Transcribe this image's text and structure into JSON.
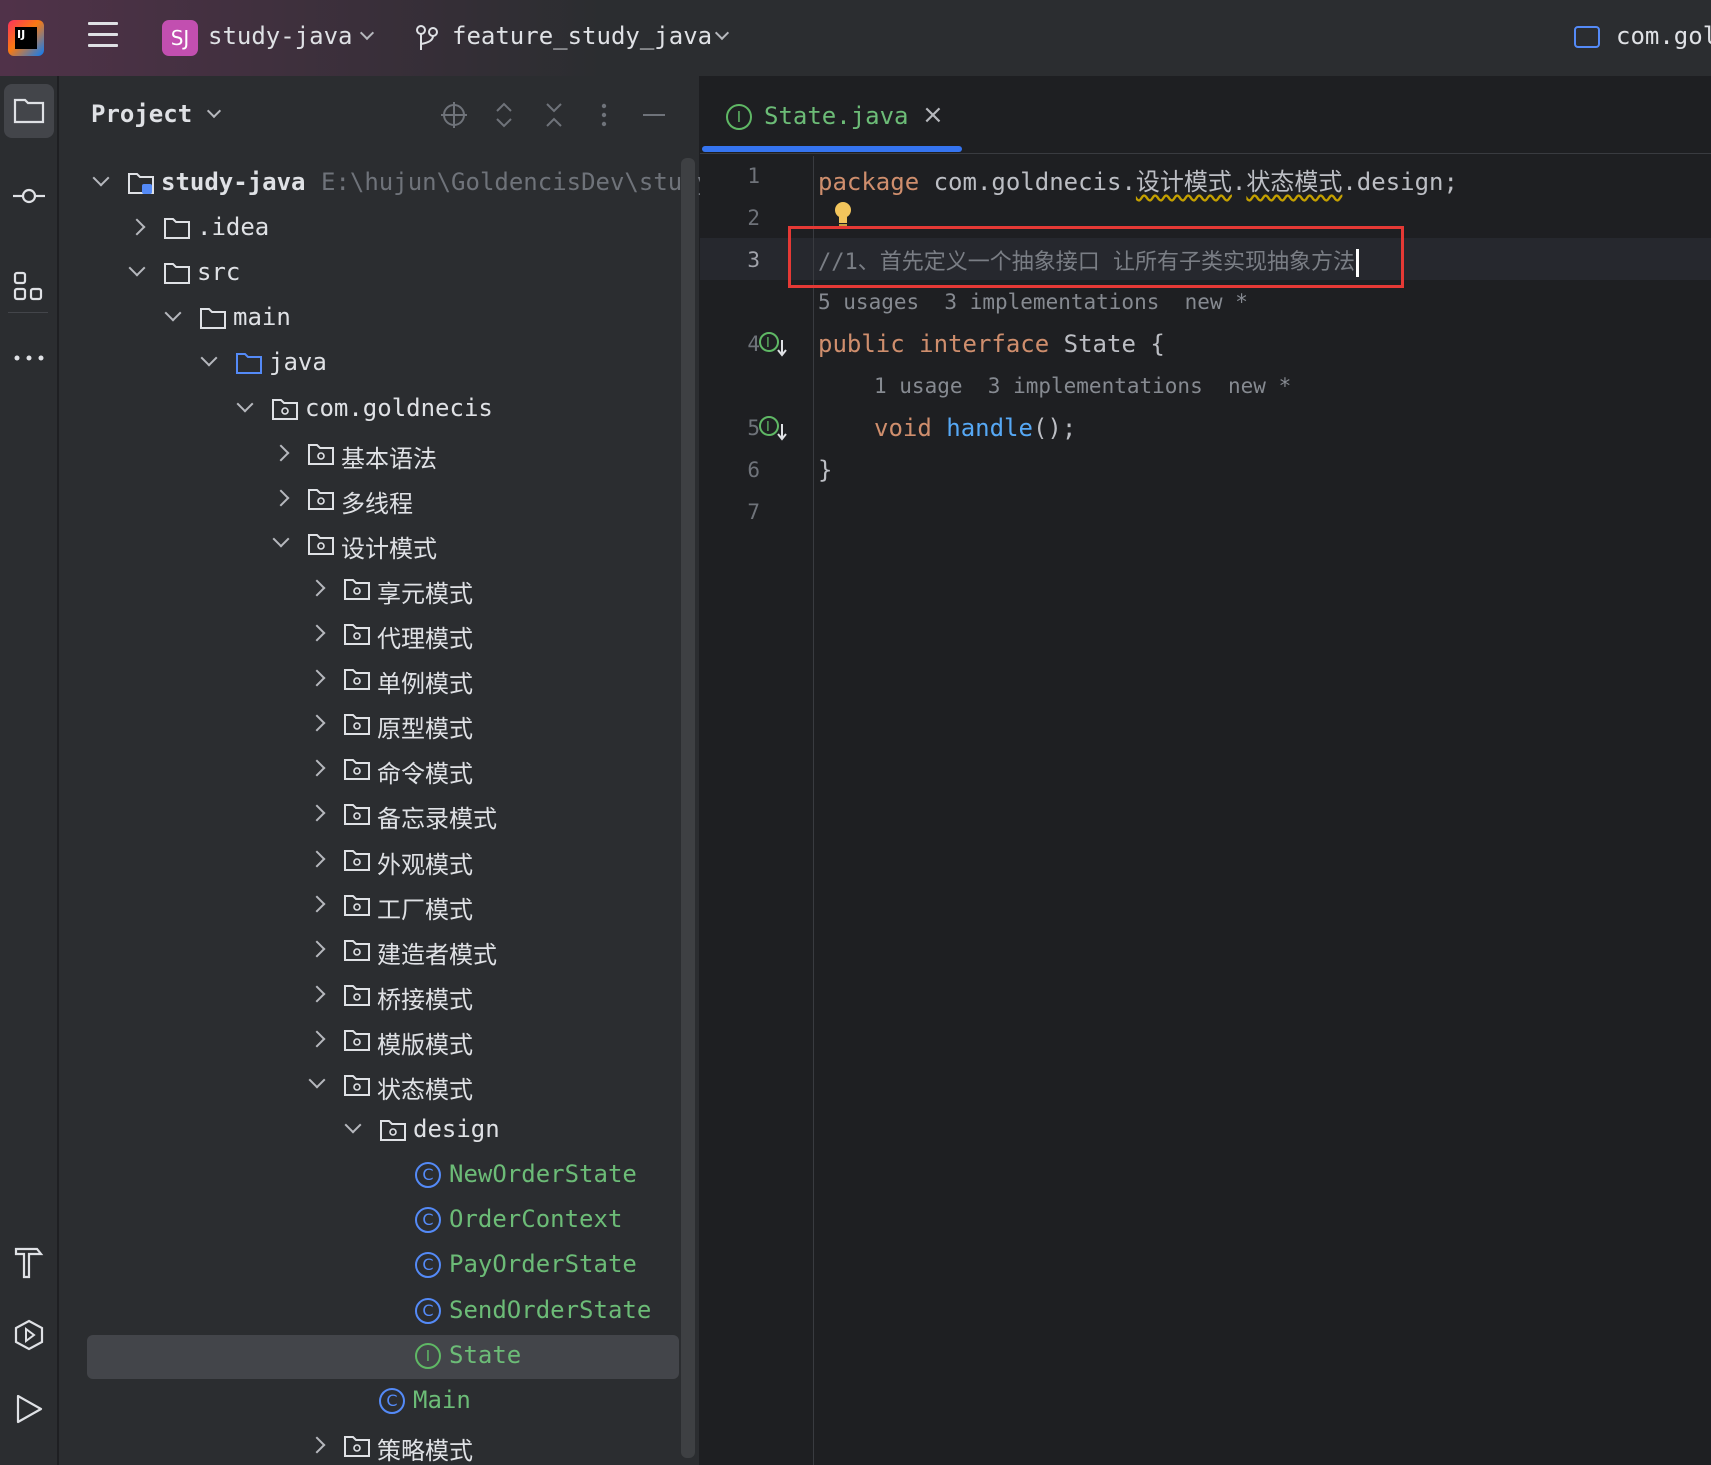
{
  "titlebar": {
    "project_badge": "SJ",
    "project_name": "study-java",
    "branch_name": "feature_study_java",
    "right_config": "com.gol"
  },
  "project_panel": {
    "title": "Project",
    "tree": [
      {
        "label": "study-java",
        "path": "E:\\hujun\\GoldencisDev\\study-",
        "type": "module",
        "level": 0,
        "open": true
      },
      {
        "label": ".idea",
        "type": "folder",
        "level": 1,
        "open": false
      },
      {
        "label": "src",
        "type": "folder",
        "level": 1,
        "open": true
      },
      {
        "label": "main",
        "type": "folder",
        "level": 2,
        "open": true
      },
      {
        "label": "java",
        "type": "source",
        "level": 3,
        "open": true
      },
      {
        "label": "com.goldnecis",
        "type": "package",
        "level": 4,
        "open": true
      },
      {
        "label": "基本语法",
        "type": "package",
        "level": 5,
        "open": false
      },
      {
        "label": "多线程",
        "type": "package",
        "level": 5,
        "open": false
      },
      {
        "label": "设计模式",
        "type": "package",
        "level": 5,
        "open": true
      },
      {
        "label": "享元模式",
        "type": "package",
        "level": 6,
        "open": false
      },
      {
        "label": "代理模式",
        "type": "package",
        "level": 6,
        "open": false
      },
      {
        "label": "单例模式",
        "type": "package",
        "level": 6,
        "open": false
      },
      {
        "label": "原型模式",
        "type": "package",
        "level": 6,
        "open": false
      },
      {
        "label": "命令模式",
        "type": "package",
        "level": 6,
        "open": false
      },
      {
        "label": "备忘录模式",
        "type": "package",
        "level": 6,
        "open": false
      },
      {
        "label": "外观模式",
        "type": "package",
        "level": 6,
        "open": false
      },
      {
        "label": "工厂模式",
        "type": "package",
        "level": 6,
        "open": false
      },
      {
        "label": "建造者模式",
        "type": "package",
        "level": 6,
        "open": false
      },
      {
        "label": "桥接模式",
        "type": "package",
        "level": 6,
        "open": false
      },
      {
        "label": "模版模式",
        "type": "package",
        "level": 6,
        "open": false
      },
      {
        "label": "状态模式",
        "type": "package",
        "level": 6,
        "open": true
      },
      {
        "label": "design",
        "type": "package",
        "level": 7,
        "open": true
      },
      {
        "label": "NewOrderState",
        "type": "class",
        "level": 8
      },
      {
        "label": "OrderContext",
        "type": "class",
        "level": 8
      },
      {
        "label": "PayOrderState",
        "type": "class",
        "level": 8
      },
      {
        "label": "SendOrderState",
        "type": "class",
        "level": 8
      },
      {
        "label": "State",
        "type": "interface",
        "level": 8,
        "selected": true
      },
      {
        "label": "Main",
        "type": "class",
        "level": 7
      },
      {
        "label": "策略模式",
        "type": "package",
        "level": 6,
        "open": false
      }
    ]
  },
  "editor": {
    "tab": {
      "label": "State.java",
      "close": "×"
    },
    "line_numbers": [
      "1",
      "2",
      "3",
      "4",
      "5",
      "6",
      "7"
    ],
    "line1": {
      "kw": "package",
      "pre": "com.goldnecis.",
      "pkg1": "设计模式",
      "dot": ".",
      "pkg2": "状态模式",
      "post": ".design;"
    },
    "line3": {
      "comment": "//1、首先定义一个抽象接口 让所有子类实现抽象方法"
    },
    "inlay1": "5 usages  3 implementations  new *",
    "line4": {
      "kw1": "public",
      "kw2": "interface",
      "rest": "State {"
    },
    "inlay2": "1 usage  3 implementations  new *",
    "line5": {
      "kw": "void",
      "fn": "handle",
      "rest": "();"
    },
    "line6": "}"
  }
}
